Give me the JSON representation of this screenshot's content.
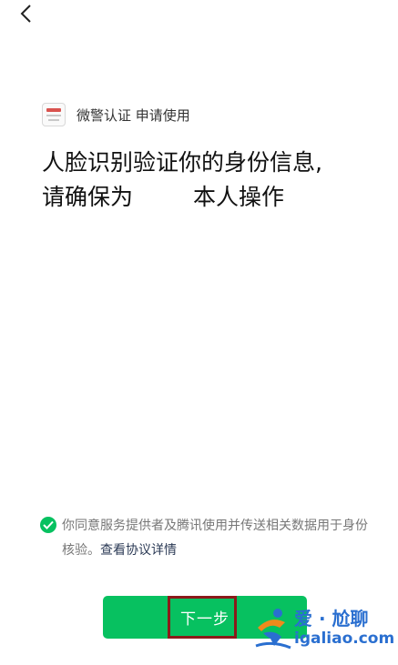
{
  "nav": {
    "back_icon": "chevron-left-icon"
  },
  "requester": {
    "text": "微警认证 申请使用",
    "icon": "app-logo-icon"
  },
  "headline": {
    "line1": "人脸识别验证你的身份信息,",
    "line2_prefix": "请确保为",
    "line2_suffix": "本人操作"
  },
  "agreement": {
    "check_icon": "check-circle-icon",
    "text": "你同意服务提供者及腾讯使用并传送相关数据用于身份核验。",
    "link": "查看协议详情",
    "accent": "#07c160"
  },
  "primary_button": {
    "label": "下一步",
    "color": "#07c160"
  },
  "watermark": {
    "title": "爱 · 尬聊",
    "domain": "igaliao.com"
  }
}
